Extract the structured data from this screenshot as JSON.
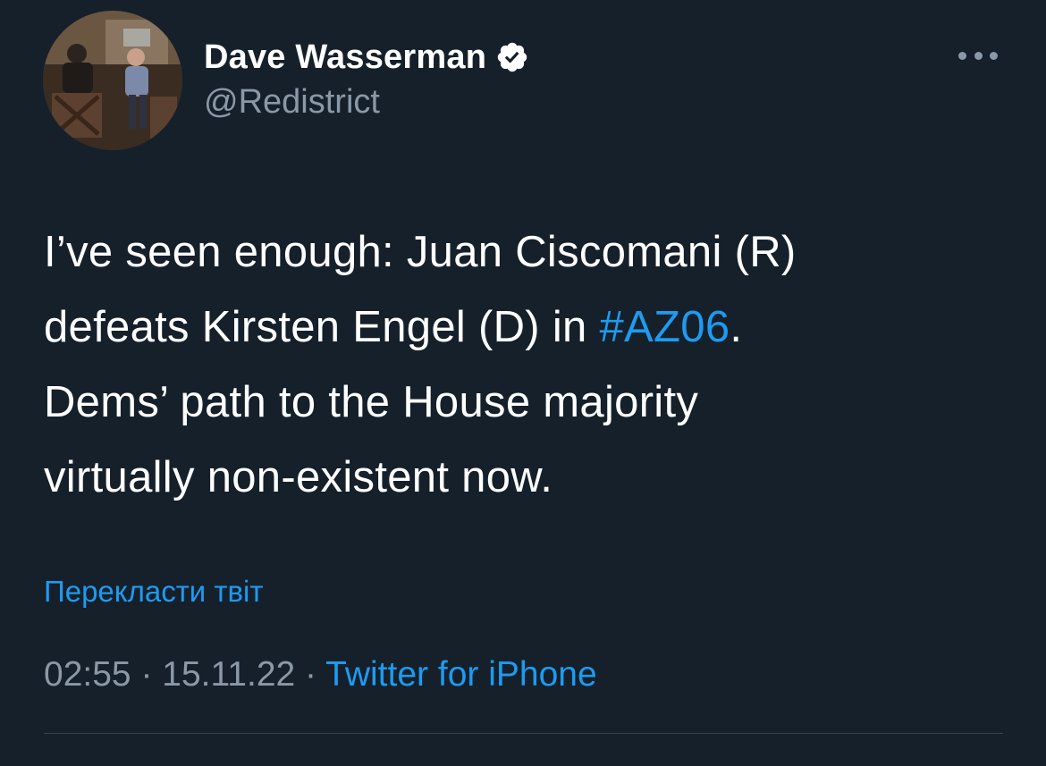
{
  "author": {
    "display_name": "Dave Wasserman",
    "handle": "@Redistrict",
    "verified": true
  },
  "icons": {
    "verified": "verified-badge-icon",
    "more": "more-options-icon"
  },
  "tweet": {
    "line1": "I’ve seen enough: Juan Ciscomani (R)",
    "line2_before": "defeats Kirsten Engel (D) in ",
    "hashtag": "#AZ06",
    "line2_after": ".",
    "line3": "Dems’ path to the House majority",
    "line4": "virtually non-existent now."
  },
  "translate_label": "Перекласти твіт",
  "meta": {
    "time": "02:55",
    "separator1": " · ",
    "date": "15.11.22",
    "separator2": " · ",
    "source": "Twitter for iPhone"
  },
  "colors": {
    "background": "#15202b",
    "text": "#ffffff",
    "secondary": "#8b98a5",
    "accent": "#1d9bf0",
    "divider": "#38444d"
  }
}
